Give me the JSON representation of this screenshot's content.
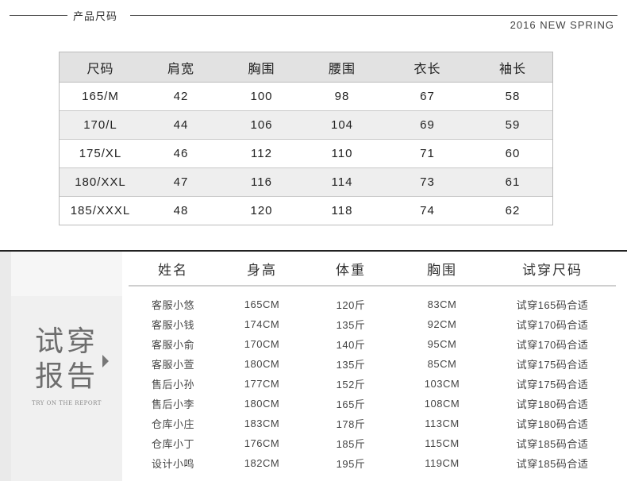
{
  "section": {
    "title": "产品尺码",
    "season": "2016 NEW  SPRING"
  },
  "size_table": {
    "headers": [
      "尺码",
      "肩宽",
      "胸围",
      "腰围",
      "衣长",
      "袖长"
    ],
    "rows": [
      [
        "165/M",
        "42",
        "100",
        "98",
        "67",
        "58"
      ],
      [
        "170/L",
        "44",
        "106",
        "104",
        "69",
        "59"
      ],
      [
        "175/XL",
        "46",
        "112",
        "110",
        "71",
        "60"
      ],
      [
        "180/XXL",
        "47",
        "116",
        "114",
        "73",
        "61"
      ],
      [
        "185/XXXL",
        "48",
        "120",
        "118",
        "74",
        "62"
      ]
    ]
  },
  "report": {
    "side_title_line1": "试穿",
    "side_title_line2": "报告",
    "side_subtitle": "TRY ON THE REPORT",
    "headers": [
      "姓名",
      "身高",
      "体重",
      "胸围",
      "试穿尺码"
    ],
    "rows": [
      [
        "客服小悠",
        "165CM",
        "120斤",
        "83CM",
        "试穿165码合适"
      ],
      [
        "客服小钱",
        "174CM",
        "135斤",
        "92CM",
        "试穿170码合适"
      ],
      [
        "客服小俞",
        "170CM",
        "140斤",
        "95CM",
        "试穿170码合适"
      ],
      [
        "客服小萱",
        "180CM",
        "135斤",
        "85CM",
        "试穿175码合适"
      ],
      [
        "售后小孙",
        "177CM",
        "152斤",
        "103CM",
        "试穿175码合适"
      ],
      [
        "售后小李",
        "180CM",
        "165斤",
        "108CM",
        "试穿180码合适"
      ],
      [
        "仓库小庄",
        "183CM",
        "178斤",
        "113CM",
        "试穿180码合适"
      ],
      [
        "仓库小丁",
        "176CM",
        "185斤",
        "115CM",
        "试穿185码合适"
      ],
      [
        "设计小鸣",
        "182CM",
        "195斤",
        "119CM",
        "试穿185码合适"
      ]
    ]
  }
}
